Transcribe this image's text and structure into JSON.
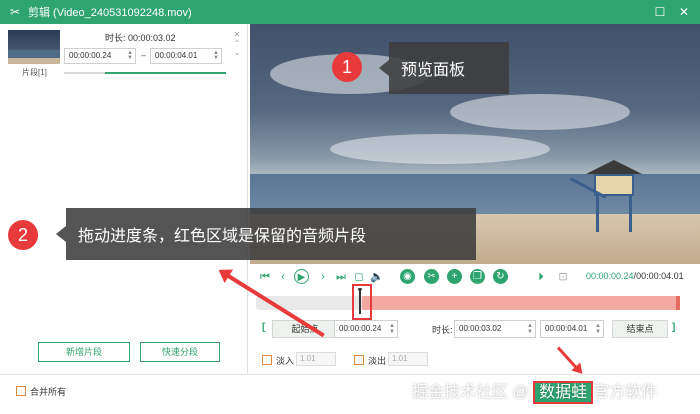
{
  "window": {
    "title": "剪辑 (Video_240531092248.mov)",
    "app_icon": "scissors-icon",
    "maximize_icon": "maximize-icon",
    "close_icon": "close-icon"
  },
  "clip": {
    "label": "片段[1]",
    "duration_label": "时长: 00:00:03.02",
    "start_time": "00:00:00.24",
    "end_time": "00:00:04.01",
    "range_separator": "–",
    "progress": 0.25
  },
  "left_buttons": {
    "add_segment": "新增片段",
    "quick_split": "快速分段"
  },
  "annotations": {
    "badge_1": "1",
    "callout_1": "预览面板",
    "badge_2": "2",
    "callout_2": "拖动进度条，红色区域是保留的音频片段"
  },
  "controls": {
    "time_current": "00:00:00.24",
    "time_separator": "/",
    "time_total": "00:00:04.01",
    "icons": [
      "skip-start-icon",
      "prev-icon",
      "play-icon",
      "next-icon",
      "skip-end-icon",
      "stop-icon",
      "volume-icon",
      "camera-icon",
      "scissor-icon",
      "add-icon",
      "copy-icon",
      "refresh-icon",
      "play-selection-icon",
      "loop-icon"
    ]
  },
  "timeline": {
    "selection_start": 0.25,
    "selection_end": 1.0
  },
  "range_row": {
    "bracket_left": "[",
    "start_button": "起始点",
    "start_time": "00:00:00.24",
    "duration_label": "时长:",
    "duration_value": "00:00:03.02",
    "end_time": "00:00:04.01",
    "end_button": "结束点",
    "bracket_right": "]"
  },
  "fade": {
    "fade_in_label": "淡入",
    "fade_in_value": "1.01",
    "fade_out_label": "淡出",
    "fade_out_value": "1.01"
  },
  "bottom": {
    "merge_all": "合并所有"
  },
  "watermark": {
    "prefix": "掘金技术社区 @ ",
    "highlight": "数据蛙",
    "suffix": "官方软件"
  }
}
